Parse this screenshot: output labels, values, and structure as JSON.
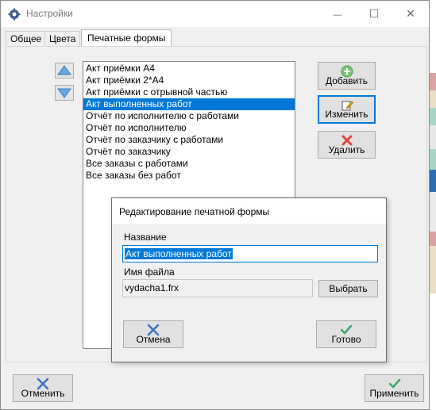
{
  "window": {
    "title": "Настройки",
    "controls": {
      "minimize": "—",
      "maximize": "☐",
      "close": "✕"
    }
  },
  "tabs": [
    {
      "label": "Общее"
    },
    {
      "label": "Цвета"
    },
    {
      "label": "Печатные формы",
      "active": true
    }
  ],
  "forms_list": {
    "items": [
      "Акт приёмки А4",
      "Акт приёмки 2*А4",
      "Акт приёмки с отрывной частью",
      "Акт выполненных работ",
      "Отчёт по исполнителю с работами",
      "Отчёт по исполнителю",
      "Отчёт по заказчику с работами",
      "Отчёт по заказчику",
      "Все заказы с работами",
      "Все заказы без работ"
    ],
    "selected_index": 3
  },
  "side_buttons": {
    "add": "Добавить",
    "edit": "Изменить",
    "delete": "Удалить"
  },
  "bottom_buttons": {
    "cancel": "Отменить",
    "apply": "Применить"
  },
  "dialog": {
    "title": "Редактирование печатной формы",
    "name_label": "Название",
    "name_value": "Акт выполненных работ",
    "file_label": "Имя файла",
    "file_value": "vydacha1.frx",
    "browse_button": "Выбрать",
    "cancel_button": "Отмена",
    "ok_button": "Готово"
  },
  "colors": {
    "accent": "#0078d7",
    "add_icon": "#5cb85c",
    "delete_icon": "#e0443e",
    "cancel_icon": "#3b73c4",
    "ok_icon": "#3ea66a",
    "arrow": "#6aa6de"
  }
}
